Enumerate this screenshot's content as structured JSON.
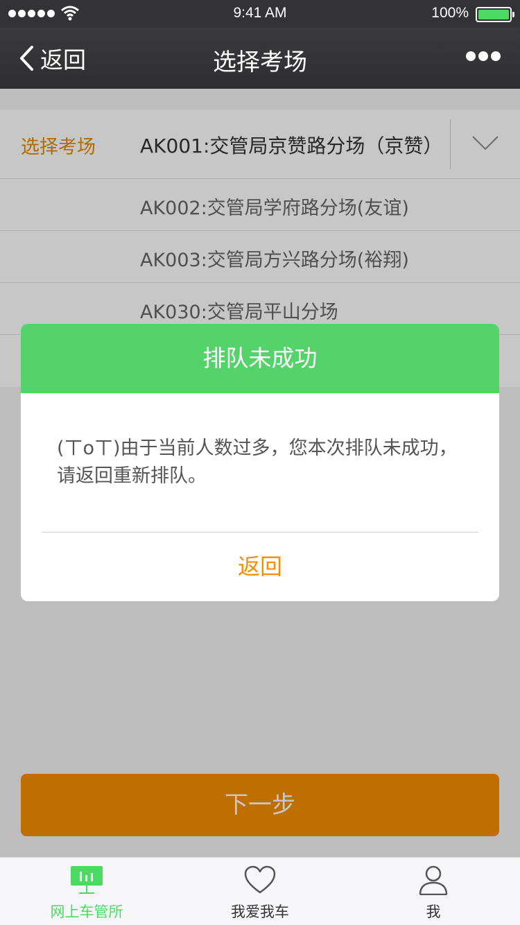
{
  "status_bar": {
    "time": "9:41 AM",
    "battery_percent": "100%",
    "battery_level": 1.0
  },
  "nav": {
    "back_label": "返回",
    "title": "选择考场"
  },
  "exam_select": {
    "label": "选择考场",
    "selected": "AK001:交管局京赞路分场（京赞）",
    "options": [
      "AK002:交管局学府路分场(友谊)",
      "AK003:交管局方兴路分场(裕翔)",
      "AK030:交管局平山分场"
    ]
  },
  "next_button": {
    "label": "下一步"
  },
  "modal": {
    "title": "排队未成功",
    "message": "(ㄒoㄒ)由于当前人数过多，您本次排队未成功，请返回重新排队。",
    "button_label": "返回"
  },
  "tab_bar": {
    "tabs": [
      {
        "label": "网上车管所",
        "icon": "chart-board-icon",
        "active": true
      },
      {
        "label": "我爱我车",
        "icon": "heart-icon",
        "active": false
      },
      {
        "label": "我",
        "icon": "user-icon",
        "active": false
      }
    ]
  },
  "colors": {
    "accent_orange": "#f48f00",
    "success_green": "#53d36a",
    "nav_dark": "#333336"
  }
}
